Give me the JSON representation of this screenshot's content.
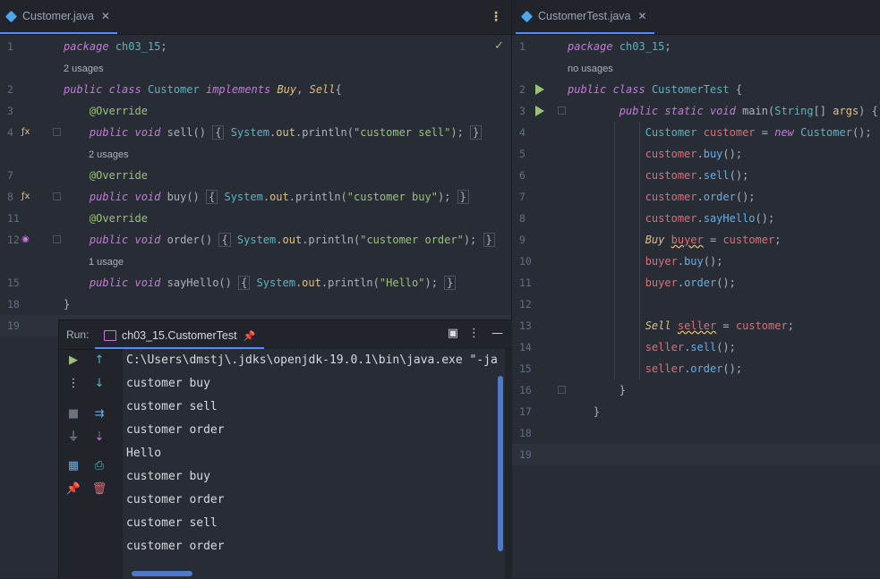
{
  "left_editor": {
    "tab": {
      "name": "Customer.java",
      "close": "✕",
      "menu": "⋮"
    },
    "check": "✓",
    "lines": [
      {
        "num": "1",
        "html": "<span class='kw'>package</span> <span class='cls2'>ch03_15</span>;"
      },
      {
        "num": "",
        "usage": "2 usages"
      },
      {
        "num": "2",
        "html": "<span class='kw'>public class</span> <span class='cls2'>Customer</span> <span class='kw'>implements</span> <span class='iface'>Buy</span>, <span class='iface'>Sell</span>{"
      },
      {
        "num": "3",
        "html": "    <span class='ann'>@Override</span>"
      },
      {
        "num": "4",
        "icon": "ƒx",
        "fold": true,
        "html": "    <span class='kw'>public void</span> <span class='pk'>sell</span>() <span class='brace-box'>{</span> <span class='sys'>System</span>.<span class='out'>out</span>.println(<span class='str'>\"customer sell\"</span>); <span class='brace-box'>}</span>"
      },
      {
        "num": "",
        "usage": "2 usages",
        "indent": true
      },
      {
        "num": "7",
        "html": "    <span class='ann'>@Override</span>"
      },
      {
        "num": "8",
        "icon": "ƒx",
        "fold": true,
        "html": "    <span class='kw'>public void</span> <span class='pk'>buy</span>() <span class='brace-box'>{</span> <span class='sys'>System</span>.<span class='out'>out</span>.println(<span class='str'>\"customer buy\"</span>); <span class='brace-box'>}</span>"
      },
      {
        "num": "11",
        "html": "    <span class='ann'>@Override</span>"
      },
      {
        "num": "12",
        "icon": "◉",
        "fold": true,
        "html": "    <span class='kw'>public void</span> <span class='pk'>order</span>() <span class='brace-box'>{</span> <span class='sys'>System</span>.<span class='out'>out</span>.println(<span class='str'>\"customer order\"</span>); <span class='brace-box'>}</span>"
      },
      {
        "num": "",
        "usage": "1 usage",
        "indent": true
      },
      {
        "num": "15",
        "html": "    <span class='kw'>public void</span> <span class='pk'>sayHello</span>() <span class='brace-box'>{</span> <span class='sys'>System</span>.<span class='out'>out</span>.println(<span class='str'>\"Hello\"</span>); <span class='brace-box'>}</span>"
      },
      {
        "num": "18",
        "html": "}"
      },
      {
        "num": "19",
        "html": "",
        "current": true
      }
    ]
  },
  "right_editor": {
    "tab": {
      "name": "CustomerTest.java",
      "close": "✕"
    },
    "lines": [
      {
        "num": "1",
        "html": "<span class='kw'>package</span> <span class='cls2'>ch03_15</span>;"
      },
      {
        "num": "",
        "usage": "no usages"
      },
      {
        "num": "2",
        "run": true,
        "html": "<span class='kw'>public class</span> <span class='cls2'>CustomerTest</span> {"
      },
      {
        "num": "3",
        "run": true,
        "fold": true,
        "html": "        <span class='kw'>public static void</span> <span class='pk'>main</span>(<span class='cls2'>String</span>[] <span class='param'>args</span>) {"
      },
      {
        "num": "4",
        "html": "            <span class='cls2'>Customer</span> <span class='var'>customer</span> = <span class='kw'>new</span> <span class='cls2'>Customer</span>();"
      },
      {
        "num": "5",
        "html": "            <span class='var'>customer</span>.<span class='fn'>buy</span>();"
      },
      {
        "num": "6",
        "html": "            <span class='var'>customer</span>.<span class='fn'>sell</span>();"
      },
      {
        "num": "7",
        "html": "            <span class='var'>customer</span>.<span class='fn'>order</span>();"
      },
      {
        "num": "8",
        "html": "            <span class='var'>customer</span>.<span class='fn'>sayHello</span>();"
      },
      {
        "num": "9",
        "html": "            <span class='iface'>Buy</span> <span class='var squiggle'>buyer</span> = <span class='var'>customer</span>;"
      },
      {
        "num": "10",
        "html": "            <span class='var'>buyer</span>.<span class='fn'>buy</span>();"
      },
      {
        "num": "11",
        "html": "            <span class='var'>buyer</span>.<span class='fn'>order</span>();"
      },
      {
        "num": "12",
        "html": ""
      },
      {
        "num": "13",
        "html": "            <span class='iface'>Sell</span> <span class='var squiggle'>seller</span> = <span class='var'>customer</span>;"
      },
      {
        "num": "14",
        "html": "            <span class='var'>seller</span>.<span class='fn'>sell</span>();"
      },
      {
        "num": "15",
        "html": "            <span class='var'>seller</span>.<span class='fn'>order</span>();"
      },
      {
        "num": "16",
        "fold": true,
        "html": "        }"
      },
      {
        "num": "17",
        "html": "    }"
      },
      {
        "num": "18",
        "html": ""
      },
      {
        "num": "19",
        "html": "",
        "current": true
      }
    ]
  },
  "run_panel": {
    "label": "Run:",
    "tab_label": "ch03_15.CustomerTest",
    "pin": "📌",
    "header_buttons": {
      "layout": "▣",
      "more": "⋮",
      "minimize": "—"
    },
    "console_lines": [
      "C:\\Users\\dmstj\\.jdks\\openjdk-19.0.1\\bin\\java.exe \"-ja",
      "customer buy",
      "customer sell",
      "customer order",
      "Hello",
      "customer buy",
      "customer order",
      "customer sell",
      "customer order"
    ],
    "tools_col1": [
      {
        "name": "rerun-icon",
        "glyph": "▶",
        "color": "#98c379"
      },
      {
        "name": "more-actions-icon",
        "glyph": "⋮",
        "color": "#d7dae0"
      },
      {
        "name": "stop-icon",
        "glyph": "■",
        "color": "#6b717d"
      },
      {
        "name": "plug-icon",
        "glyph": "⏚",
        "color": "#9da5b4"
      },
      {
        "name": "layout-icon",
        "glyph": "▦",
        "color": "#61afef"
      },
      {
        "name": "pin-tab-icon",
        "glyph": "📌",
        "color": "#c678dd"
      }
    ],
    "tools_col2": [
      {
        "name": "scroll-up-icon",
        "glyph": "↑",
        "color": "#56b6c2"
      },
      {
        "name": "scroll-down-icon",
        "glyph": "↓",
        "color": "#56b6c2"
      },
      {
        "name": "soft-wrap-icon",
        "glyph": "⇉",
        "color": "#61afef"
      },
      {
        "name": "scroll-to-end-icon",
        "glyph": "⇣",
        "color": "#c678dd"
      },
      {
        "name": "print-icon",
        "glyph": "⎙",
        "color": "#56b6c2"
      },
      {
        "name": "clear-icon",
        "glyph": "🗑",
        "color": "#e06c75"
      }
    ]
  }
}
